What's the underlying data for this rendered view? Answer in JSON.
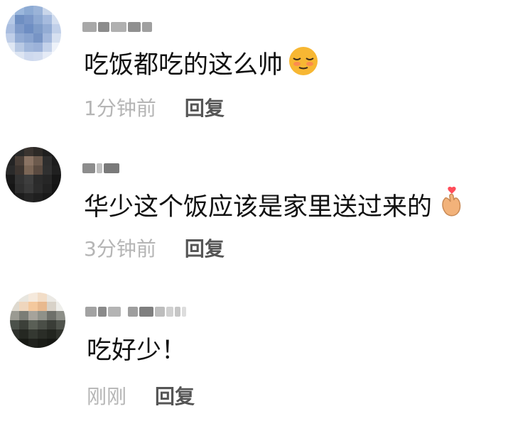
{
  "comments": [
    {
      "username": "",
      "text": "吃饭都吃的这么帅",
      "emoji": "relieved-face-emoji",
      "time": "1分钟前",
      "reply_label": "回复"
    },
    {
      "username": "",
      "text": "华少这个饭应该是家里送过来的",
      "emoji": "finger-heart-emoji",
      "time": "3分钟前",
      "reply_label": "回复"
    },
    {
      "username": "",
      "text": "吃好少！",
      "emoji": "",
      "time": "刚刚",
      "reply_label": "回复"
    }
  ],
  "colors": {
    "timestamp": "#b5b5b5",
    "reply": "#555555",
    "text": "#111111",
    "emoji_face": "#f7b733",
    "emoji_blush": "#ff6f61"
  }
}
